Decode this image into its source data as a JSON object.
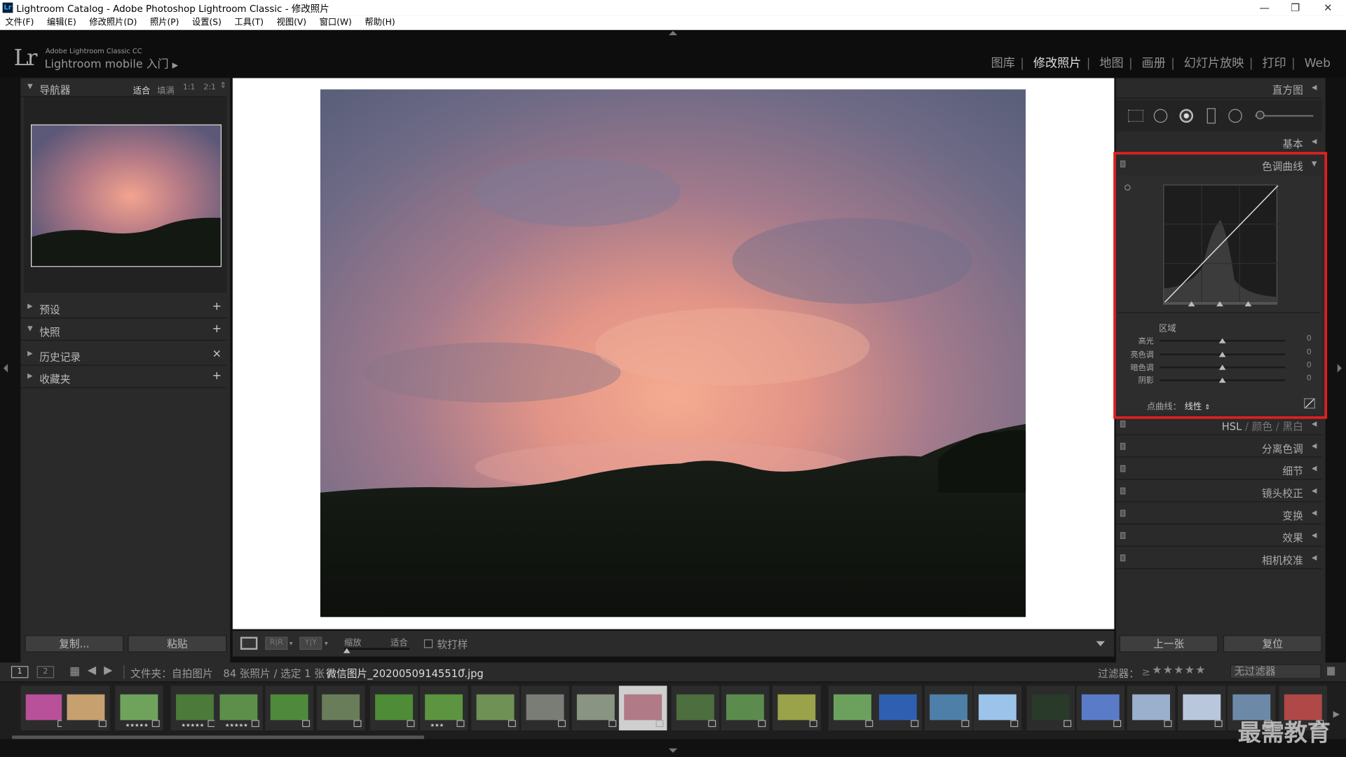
{
  "window": {
    "title": "Lightroom Catalog - Adobe Photoshop Lightroom Classic - 修改照片",
    "icon_label": "Lr",
    "controls": [
      "—",
      "❐",
      "✕"
    ]
  },
  "menu": [
    "文件(F)",
    "编辑(E)",
    "修改照片(D)",
    "照片(P)",
    "设置(S)",
    "工具(T)",
    "视图(V)",
    "窗口(W)",
    "帮助(H)"
  ],
  "header": {
    "logo": "Lr",
    "brand_small": "Adobe Lightroom Classic CC",
    "brand_main": "Lightroom mobile 入门",
    "brand_arrow": "▶",
    "modules": [
      "图库",
      "修改照片",
      "地图",
      "画册",
      "幻灯片放映",
      "打印",
      "Web"
    ],
    "active_module": "修改照片"
  },
  "left_panel": {
    "navigator": {
      "title": "导航器",
      "zoom_options": [
        "适合",
        "填满",
        "1:1",
        "2:1"
      ]
    },
    "sections": [
      {
        "label": "预设",
        "action": "+"
      },
      {
        "label": "快照",
        "action": "+"
      },
      {
        "label": "历史记录",
        "action": "×"
      },
      {
        "label": "收藏夹",
        "action": "+"
      }
    ],
    "copy_button": "复制...",
    "paste_button": "粘贴"
  },
  "right_panel": {
    "histogram_title": "直方图",
    "basic_title": "基本",
    "tone_curve": {
      "title": "色调曲线",
      "region_label": "区域",
      "sliders": [
        {
          "label": "高光",
          "value": "0"
        },
        {
          "label": "亮色调",
          "value": "0"
        },
        {
          "label": "暗色调",
          "value": "0"
        },
        {
          "label": "阴影",
          "value": "0"
        }
      ],
      "point_curve_label": "点曲线：",
      "point_curve_value": "线性",
      "highlight_color": "#e02020"
    },
    "hsl": {
      "hsl": "HSL",
      "color": "颜色",
      "bw": "黑白",
      "sep": "/"
    },
    "sections": [
      "分离色调",
      "细节",
      "镜头校正",
      "变换",
      "效果",
      "相机校准"
    ],
    "prev_button": "上一张",
    "reset_button": "复位"
  },
  "toolbar": {
    "zoom_label": "缩放",
    "zoom_value": "适合",
    "softproof_label": "软打样"
  },
  "filmstrip_bar": {
    "page1": "1",
    "page2": "2",
    "folder_label": "文件夹：自拍图片",
    "count_label": "84 张照片 / 选定 1 张 /",
    "filename": "微信图片_20200509145510.jpg",
    "filter_label": "过滤器：",
    "filter_cond": "≥",
    "filter_stars": "★★★★★",
    "filter_value": "无过滤器"
  },
  "thumbnails": [
    {
      "icon": "flower-photo",
      "stars": ""
    },
    {
      "icon": "sunset-field-photo",
      "stars": ""
    },
    {
      "icon": "field-photo",
      "stars": "★★★★★"
    },
    {
      "icon": "tree-photo",
      "stars": "★★★★★"
    },
    {
      "icon": "landscape-photo",
      "stars": "★★★★★"
    },
    {
      "icon": "green-hill-photo",
      "stars": ""
    },
    {
      "icon": "road-photo",
      "stars": ""
    },
    {
      "icon": "leaves-photo",
      "stars": ""
    },
    {
      "icon": "plants-photo",
      "stars": "★★★"
    },
    {
      "icon": "bush-photo",
      "stars": ""
    },
    {
      "icon": "lake-photo",
      "stars": ""
    },
    {
      "icon": "field2-photo",
      "stars": ""
    },
    {
      "icon": "sunset-photo",
      "stars": "",
      "selected": true
    },
    {
      "icon": "trees-photo",
      "stars": ""
    },
    {
      "icon": "meadow-photo",
      "stars": ""
    },
    {
      "icon": "yellow-field-photo",
      "stars": ""
    },
    {
      "icon": "green-doc-photo",
      "stars": ""
    },
    {
      "icon": "blue-sky-photo",
      "stars": ""
    },
    {
      "icon": "lake2-photo",
      "stars": ""
    },
    {
      "icon": "sky-photo",
      "stars": ""
    },
    {
      "icon": "night-photo",
      "stars": ""
    },
    {
      "icon": "blue-abstract-photo",
      "stars": ""
    },
    {
      "icon": "silhouette-photo",
      "stars": ""
    },
    {
      "icon": "snow-photo",
      "stars": ""
    },
    {
      "icon": "water-photo",
      "stars": ""
    },
    {
      "icon": "red-flower-photo",
      "stars": ""
    }
  ],
  "watermark": "最需教育",
  "colors": {
    "panel_bg": "#2a2a2a",
    "dark_bg": "#111111",
    "highlight_box": "#e02020"
  }
}
